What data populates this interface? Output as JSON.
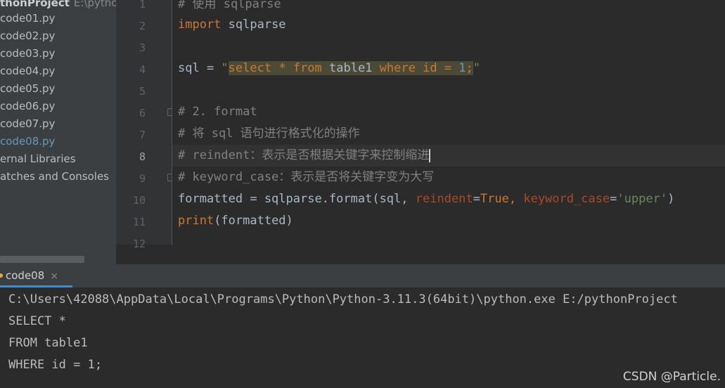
{
  "project_tree": {
    "root_label": "thonProject",
    "root_path": "E:\\pythonP",
    "files": [
      "code01.py",
      "code02.py",
      "code03.py",
      "code04.py",
      "code05.py",
      "code06.py",
      "code07.py",
      "code08.py"
    ],
    "active_file_index": 7,
    "external_libraries": "ernal Libraries",
    "scratches": "atches and Consoles"
  },
  "editor": {
    "line_numbers": [
      "1",
      "2",
      "3",
      "4",
      "5",
      "6",
      "7",
      "8",
      "9",
      "10",
      "11",
      "12"
    ],
    "current_line": "8",
    "lines": {
      "l1_comment": "# 使用 sqlparse",
      "l2_kw": "import",
      "l2_rest": " sqlparse",
      "l4_var": "sql = ",
      "l4_q1": "\"",
      "l4_kw1": "select",
      "l4_star": " * ",
      "l4_kw2": "from",
      "l4_table": " table1 ",
      "l4_kw3": "where",
      "l4_cond": " id = ",
      "l4_num": "1",
      "l4_semi": ";",
      "l4_q2": "\"",
      "l6_comment": "# 2. format",
      "l7_comment": "# 将 sql 语句进行格式化的操作",
      "l8_comment": "# reindent：表示是否根据关键字来控制缩进",
      "l9_comment": "# keyword_case：表示是否将关键字变为大写",
      "l10_a": "formatted = sqlparse.format(sql, ",
      "l10_p1": "reindent",
      "l10_eq1": "=",
      "l10_true": "True",
      "l10_comma": ", ",
      "l10_p2": "keyword_case",
      "l10_eq2": "=",
      "l10_str": "'upper'",
      "l10_close": ")",
      "l11_kw": "print",
      "l11_rest": "(formatted)"
    }
  },
  "run_panel": {
    "tab_label": "code08",
    "close_glyph": "×",
    "output": [
      "C:\\Users\\42088\\AppData\\Local\\Programs\\Python\\Python-3.11.3(64bit)\\python.exe E:/pythonProject",
      "SELECT *",
      "FROM table1",
      "WHERE id = 1;"
    ]
  },
  "watermark": "CSDN @Particle."
}
